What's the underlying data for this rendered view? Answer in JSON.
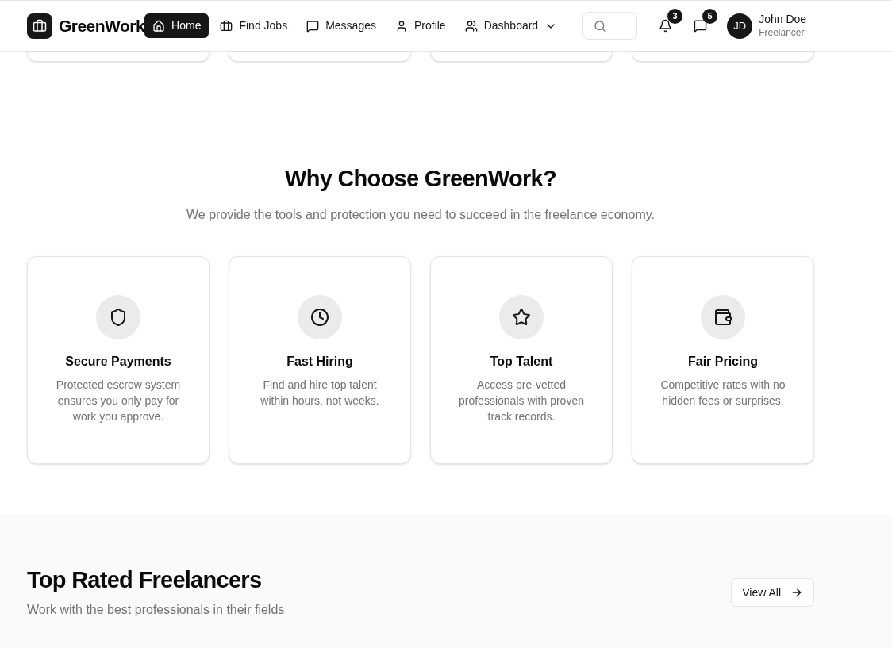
{
  "brand": {
    "name": "GreenWork"
  },
  "nav": [
    {
      "label": "Home",
      "selected": true,
      "kind": "link"
    },
    {
      "label": "Find Jobs",
      "selected": false,
      "kind": "link"
    },
    {
      "label": "Messages",
      "selected": false,
      "kind": "link"
    },
    {
      "label": "Profile",
      "selected": false,
      "kind": "link"
    },
    {
      "label": "Dashboard",
      "selected": false,
      "kind": "dropdown"
    }
  ],
  "alerts": [
    {
      "kind": "bell",
      "count": "3"
    },
    {
      "kind": "chat",
      "count": "5"
    }
  ],
  "user": {
    "initials": "JD",
    "name": "John Doe",
    "role": "Freelancer"
  },
  "features": {
    "title": "Why Choose GreenWork?",
    "subtitle": "We provide the tools and protection you need to succeed in the freelance economy.",
    "items": [
      {
        "kind": "shield",
        "title": "Secure Payments",
        "description": "Protected escrow system ensures you only pay for work you approve."
      },
      {
        "kind": "clock",
        "title": "Fast Hiring",
        "description": "Find and hire top talent within hours, not weeks."
      },
      {
        "kind": "star",
        "title": "Top Talent",
        "description": "Access pre-vetted professionals with proven track records."
      },
      {
        "kind": "wallet",
        "title": "Fair Pricing",
        "description": "Competitive rates with no hidden fees or surprises."
      }
    ]
  },
  "freelancers": {
    "title": "Top Rated Freelancers",
    "subtitle": "Work with the best professionals in their fields",
    "button": "View All"
  }
}
